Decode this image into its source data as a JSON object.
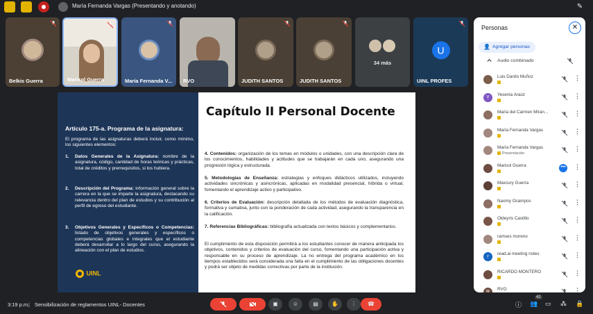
{
  "topbar": {
    "presenter_text": "María Fernanda Vargas (Presentando y anotando)"
  },
  "tiles": [
    {
      "name": "Belkis Guerra"
    },
    {
      "name": "Marisol Guerra"
    },
    {
      "name": "María Fernanda V..."
    },
    {
      "name": "RVO"
    },
    {
      "name": "JUDITH SANTOS"
    },
    {
      "name": "JUDITH SANTOS"
    },
    {
      "name": "34 más"
    },
    {
      "name": "UINL PROFES",
      "initial": "U"
    }
  ],
  "slide": {
    "title": "Capítulo II Personal Docente",
    "article_title": "Artículo 175-a. Programa de la asignatura:",
    "article_intro": "El programa de las asignaturas deberá incluir, como mínimo, los siguientes elementos:",
    "items_left": [
      {
        "num": "1.",
        "label": "Datos Generales de la Asignatura:",
        "text": " nombre de la asignatura, código, cantidad de horas teóricas y prácticas, total de créditos y prerrequisitos, si los hubiera."
      },
      {
        "num": "2.",
        "label": "Descripción del Programa:",
        "text": " información general sobre la carrera en la que se imparte la asignatura, destacando su relevancia dentro del plan de estudios y su contribución al perfil de egreso del estudiante."
      },
      {
        "num": "3.",
        "label": "Objetivos Generales y Específicos o Competencias:",
        "text": " listado de objetivos generales y específicos o competencias globales e integrales que el estudiante deberá desarrollar a lo largo del curso, asegurando la alineación con el plan de estudios."
      }
    ],
    "items_right": [
      {
        "label": "4. Contenidos:",
        "text": " organización de los temas en módulos o unidades, con una descripción clara de los conocimientos, habilidades y actitudes que se trabajarán en cada uno, asegurando una progresión lógica y estructurada."
      },
      {
        "label": "5. Metodologías de Enseñanza:",
        "text": " estrategias y enfoques didácticos utilizados, incluyendo actividades sincrónicas y asincrónicas, aplicadas en modalidad presencial, híbrida o virtual, fomentando el aprendizaje activo y participativo."
      },
      {
        "label": "6. Criterios de Evaluación:",
        "text": " descripción detallada de los métodos de evaluación diagnóstica, formativa y sumativa, junto con la ponderación de cada actividad, asegurando la transparencia en la calificación."
      },
      {
        "label": "7. Referencias Bibliográficas:",
        "text": " bibliografía actualizada con textos básicos y complementarios."
      }
    ],
    "closing": "El cumplimiento de esta disposición permitirá a los estudiantes conocer de manera anticipada los objetivos, contenidos y criterios de evaluación del curso, fomentando una participación activa y responsable en su proceso de aprendizaje. La no entrega del programa académico en los tiempos establecidos será considerada una falta en el cumplimiento de las obligaciones docentes y podrá ser objeto de medidas correctivas por parte de la institución.",
    "logo_text": "UINL"
  },
  "panel": {
    "title": "Personas",
    "add_people": "Agregar personas",
    "audio_combined": "Audio combinado",
    "people": [
      {
        "name": "Luis Danilo Muñoz",
        "initial": "",
        "color": "#7b5e4a",
        "sub": "",
        "mic": "off"
      },
      {
        "name": "Yesenia Araúz",
        "initial": "Y",
        "color": "#7e57c2",
        "sub": "",
        "mic": "off"
      },
      {
        "name": "María del Carmen Miran...",
        "initial": "",
        "color": "#8d6e63",
        "sub": "",
        "mic": "off"
      },
      {
        "name": "María Fernanda Vargas",
        "initial": "",
        "color": "#a1887f",
        "sub": "",
        "mic": "off"
      },
      {
        "name": "María Fernanda Vargas",
        "initial": "",
        "color": "#a1887f",
        "sub": "Presentación",
        "mic": "off"
      },
      {
        "name": "Marisol Guerra",
        "initial": "",
        "color": "#6d4c41",
        "sub": "",
        "mic": "speaking"
      },
      {
        "name": "Maxcury Guerra",
        "initial": "",
        "color": "#5d4037",
        "sub": "",
        "mic": "off"
      },
      {
        "name": "Naomy Ocampos",
        "initial": "",
        "color": "#8d6e63",
        "sub": "",
        "mic": "off"
      },
      {
        "name": "Oldeyris Castillo",
        "initial": "",
        "color": "#795548",
        "sub": "",
        "mic": "off"
      },
      {
        "name": "ramses moreno",
        "initial": "",
        "color": "#a1887f",
        "sub": "",
        "mic": "off"
      },
      {
        "name": "read.ai meeting notes",
        "initial": "r",
        "color": "#1565c0",
        "sub": "",
        "mic": "off"
      },
      {
        "name": "RICARDO MONTERO",
        "initial": "",
        "color": "#6d4c41",
        "sub": "",
        "mic": "off"
      },
      {
        "name": "RVO",
        "initial": "R",
        "color": "#6d4c41",
        "sub": "",
        "mic": "off"
      }
    ]
  },
  "bottombar": {
    "clock": "3:19 p.m.",
    "separator": "|",
    "meeting_title": "Sensibilización de reglamentos UINL- Docentes",
    "participant_count": "42"
  }
}
